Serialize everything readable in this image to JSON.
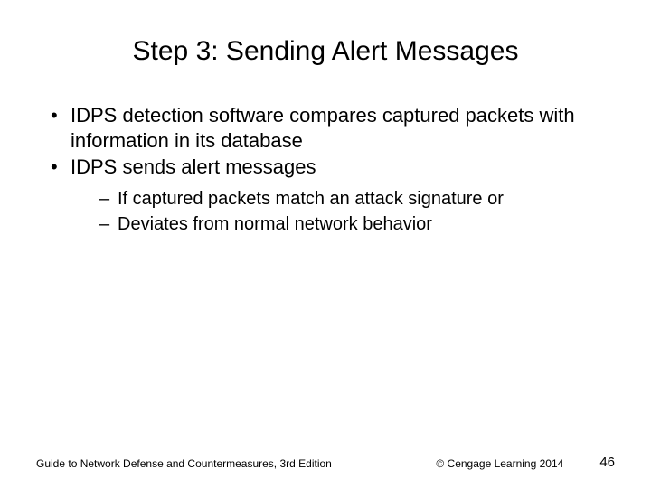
{
  "slide": {
    "title": "Step 3: Sending Alert Messages",
    "bullets": [
      {
        "text": "IDPS detection software compares captured packets with information in its database"
      },
      {
        "text": "IDPS sends alert messages",
        "subs": [
          "If captured packets match an attack signature or",
          "Deviates from normal network behavior"
        ]
      }
    ],
    "footer": {
      "left": "Guide to Network Defense and Countermeasures, 3rd  Edition",
      "center": "© Cengage Learning  2014",
      "page": "46"
    }
  }
}
